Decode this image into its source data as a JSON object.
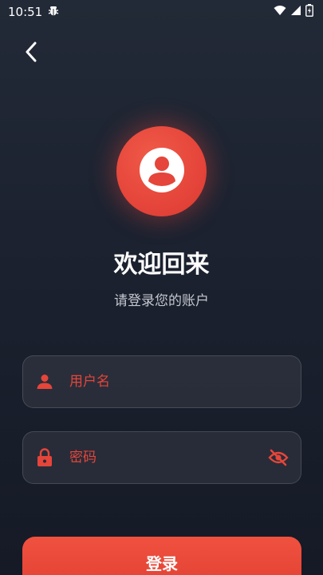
{
  "status_bar": {
    "time": "10:51",
    "app_icon": "bug-icon",
    "wifi_icon": "wifi-icon",
    "signal_icon": "signal-icon",
    "battery_icon": "battery-charging-icon"
  },
  "header": {
    "back_icon": "chevron-left-icon"
  },
  "hero": {
    "avatar_icon": "user-icon",
    "title": "欢迎回来",
    "subtitle": "请登录您的账户"
  },
  "form": {
    "username_placeholder": "用户名",
    "username_value": "",
    "password_placeholder": "密码",
    "password_value": "",
    "username_icon": "person-icon",
    "password_icon": "lock-icon",
    "visibility_icon": "eye-off-icon",
    "submit_label": "登录"
  },
  "colors": {
    "accent": "#e5453a",
    "background": "#1c2230"
  }
}
